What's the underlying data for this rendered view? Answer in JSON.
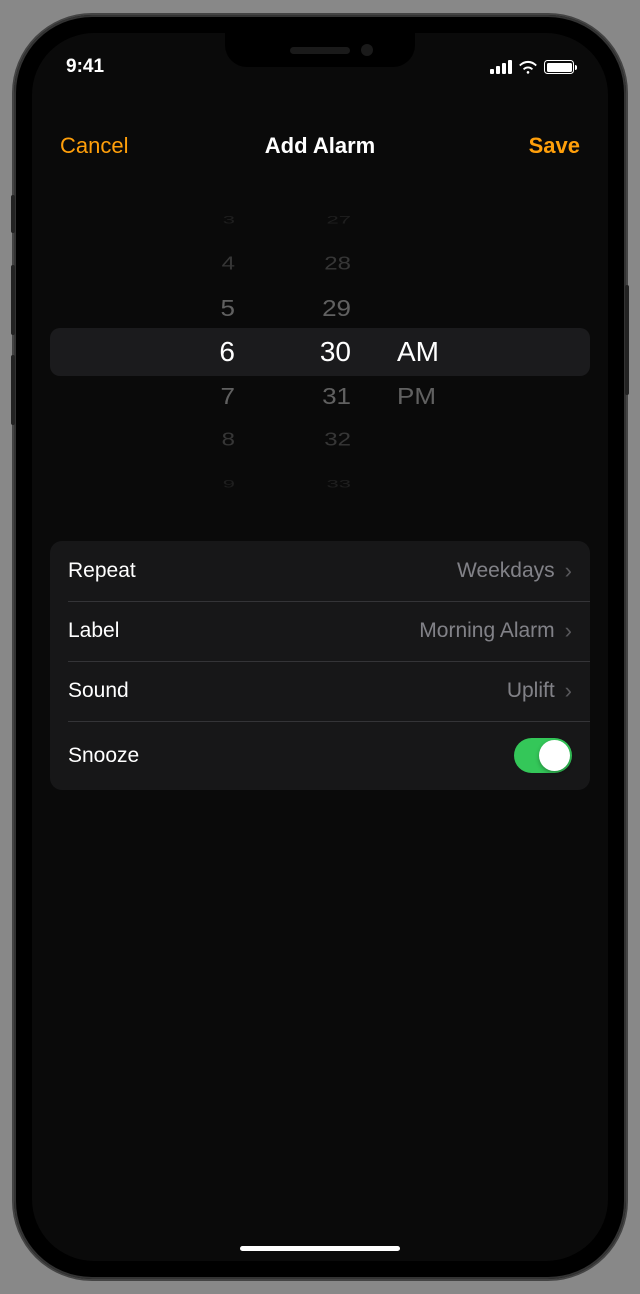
{
  "status": {
    "time": "9:41"
  },
  "nav": {
    "cancel": "Cancel",
    "title": "Add Alarm",
    "save": "Save"
  },
  "picker": {
    "hour": {
      "m3": "3",
      "m2": "4",
      "m1": "5",
      "sel": "6",
      "p1": "7",
      "p2": "8",
      "p3": "9"
    },
    "minute": {
      "m3": "27",
      "m2": "28",
      "m1": "29",
      "sel": "30",
      "p1": "31",
      "p2": "32",
      "p3": "33"
    },
    "ampm": {
      "sel": "AM",
      "p1": "PM"
    }
  },
  "settings": {
    "repeat": {
      "label": "Repeat",
      "value": "Weekdays"
    },
    "alarm_label": {
      "label": "Label",
      "value": "Morning Alarm"
    },
    "sound": {
      "label": "Sound",
      "value": "Uplift"
    },
    "snooze": {
      "label": "Snooze",
      "value": true
    }
  }
}
